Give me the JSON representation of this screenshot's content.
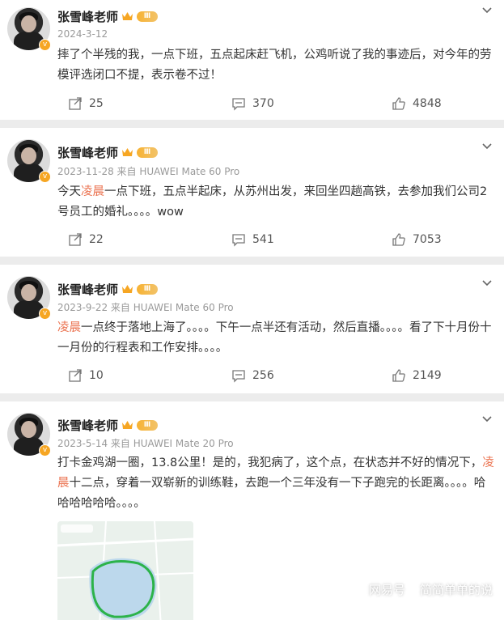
{
  "posts": [
    {
      "author": "张雪峰老师",
      "level": "Ⅲ",
      "verified": "v",
      "meta": "2024-3-12",
      "text_parts": [
        {
          "t": "摔了个半残的我，一点下班，五点起床赶飞机，公鸡听说了我的事迹后，对今年的劳模评选闭口不提，表示卷不过！",
          "hl": false
        }
      ],
      "repost": "25",
      "comment": "370",
      "like": "4848"
    },
    {
      "author": "张雪峰老师",
      "level": "Ⅲ",
      "verified": "v",
      "meta": "2023-11-28  来自 HUAWEI Mate 60 Pro",
      "text_parts": [
        {
          "t": "今天",
          "hl": false
        },
        {
          "t": "凌晨",
          "hl": true
        },
        {
          "t": "一点下班，五点半起床，从苏州出发，来回坐四趟高铁，去参加我们公司2号员工的婚礼。。。。wow",
          "hl": false
        }
      ],
      "repost": "22",
      "comment": "541",
      "like": "7053"
    },
    {
      "author": "张雪峰老师",
      "level": "Ⅲ",
      "verified": "v",
      "meta": "2023-9-22  来自 HUAWEI Mate 60 Pro",
      "text_parts": [
        {
          "t": "凌晨",
          "hl": true
        },
        {
          "t": "一点终于落地上海了。。。。下午一点半还有活动，然后直播。。。。看了下十月份十一月份的行程表和工作安排。。。。",
          "hl": false
        }
      ],
      "repost": "10",
      "comment": "256",
      "like": "2149"
    },
    {
      "author": "张雪峰老师",
      "level": "Ⅲ",
      "verified": "v",
      "meta": "2023-5-14  来自 HUAWEI Mate 20 Pro",
      "text_parts": [
        {
          "t": "打卡金鸡湖一圈，13.8公里！是的，我犯病了，这个点，在状态并不好的情况下，",
          "hl": false
        },
        {
          "t": "凌晨",
          "hl": true
        },
        {
          "t": "十二点，穿着一双崭新的训练鞋，去跑一个三年没有一下子跑完的长距离。。。。哈哈哈哈哈哈。。。。",
          "hl": false
        }
      ],
      "repost": "",
      "comment": "",
      "like": ""
    }
  ],
  "watermark": {
    "site": "网易号",
    "account": "简简单单的说"
  },
  "colors": {
    "highlight": "#eb7350",
    "badge": "#f6a623",
    "background": "#ececec"
  }
}
